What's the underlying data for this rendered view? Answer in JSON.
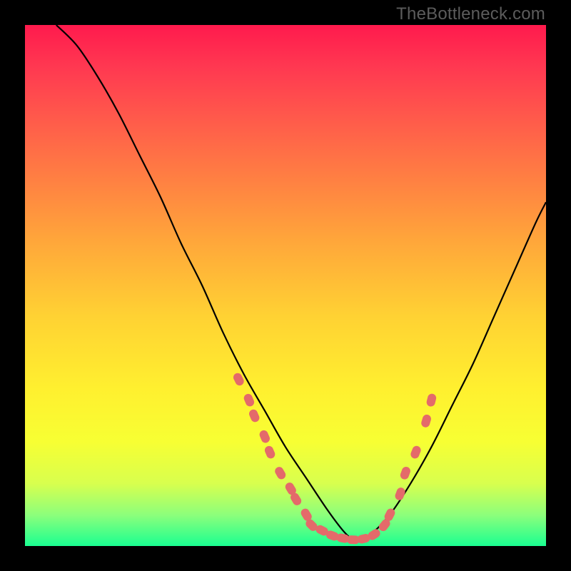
{
  "watermark": "TheBottleneck.com",
  "chart_data": {
    "type": "line",
    "title": "",
    "xlabel": "",
    "ylabel": "",
    "xlim": [
      0,
      100
    ],
    "ylim": [
      0,
      100
    ],
    "grid": false,
    "legend": false,
    "curve_left": {
      "name": "bottleneck-left",
      "color": "#000000",
      "x": [
        6,
        10,
        14,
        18,
        22,
        26,
        30,
        34,
        38,
        42,
        46,
        50,
        54,
        58,
        61,
        63
      ],
      "y": [
        100,
        96,
        90,
        83,
        75,
        67,
        58,
        50,
        41,
        33,
        26,
        19,
        13,
        7,
        3,
        1
      ]
    },
    "curve_right": {
      "name": "bottleneck-right",
      "color": "#000000",
      "x": [
        63,
        66,
        70,
        74,
        78,
        82,
        86,
        90,
        94,
        98,
        100
      ],
      "y": [
        1,
        2,
        6,
        12,
        19,
        27,
        35,
        44,
        53,
        62,
        66
      ]
    },
    "valley_markers": {
      "name": "valley-markers",
      "color": "#e46a6a",
      "points": [
        {
          "x": 41,
          "y": 32
        },
        {
          "x": 43,
          "y": 28
        },
        {
          "x": 44,
          "y": 25
        },
        {
          "x": 46,
          "y": 21
        },
        {
          "x": 47,
          "y": 18
        },
        {
          "x": 49,
          "y": 14
        },
        {
          "x": 51,
          "y": 11
        },
        {
          "x": 52,
          "y": 9
        },
        {
          "x": 54,
          "y": 6
        },
        {
          "x": 55,
          "y": 4
        },
        {
          "x": 57,
          "y": 3
        },
        {
          "x": 59,
          "y": 2
        },
        {
          "x": 61,
          "y": 1.5
        },
        {
          "x": 63,
          "y": 1.2
        },
        {
          "x": 65,
          "y": 1.4
        },
        {
          "x": 67,
          "y": 2.2
        },
        {
          "x": 69,
          "y": 4
        },
        {
          "x": 70,
          "y": 6
        },
        {
          "x": 72,
          "y": 10
        },
        {
          "x": 73,
          "y": 14
        },
        {
          "x": 75,
          "y": 18
        },
        {
          "x": 77,
          "y": 24
        },
        {
          "x": 78,
          "y": 28
        }
      ]
    }
  }
}
